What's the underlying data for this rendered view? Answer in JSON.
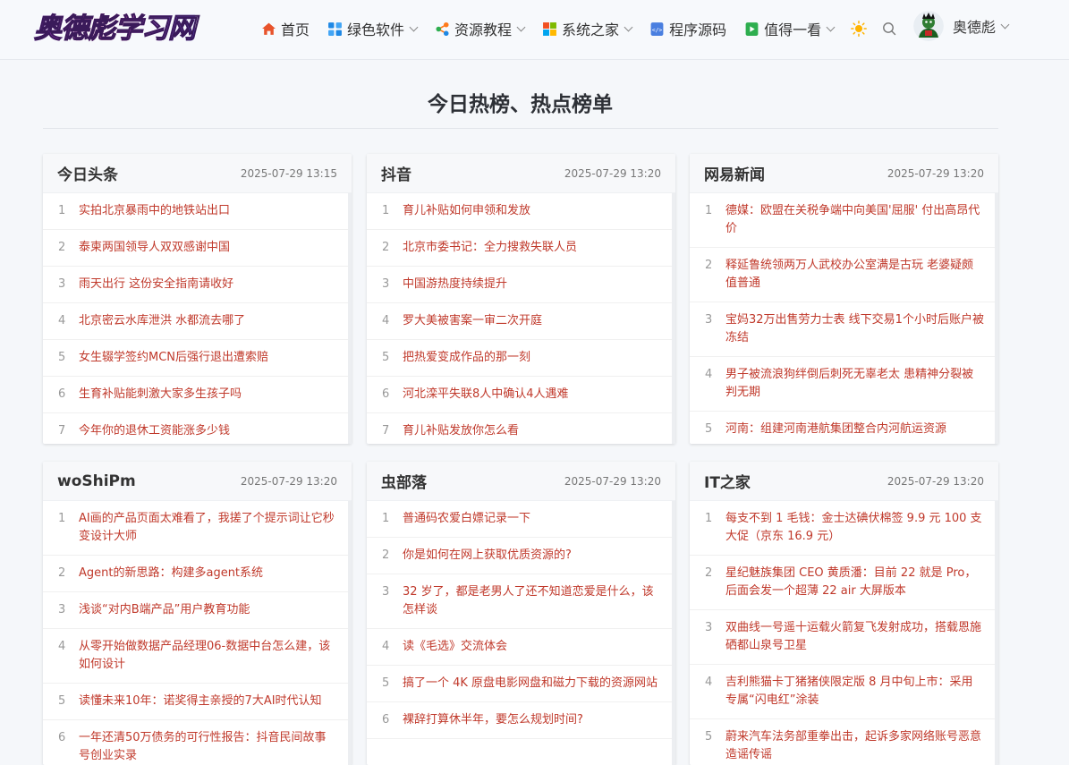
{
  "brand": {
    "logo_text": "奥德彪学习网"
  },
  "nav": {
    "items": [
      {
        "label": "首页",
        "icon": "home-icon",
        "color": "#e8532b",
        "dropdown": false
      },
      {
        "label": "绿色软件",
        "icon": "windows-grid-icon",
        "color": "#1e88e5",
        "dropdown": true
      },
      {
        "label": "资源教程",
        "icon": "share-nodes-icon",
        "color": "#ff7a1a",
        "dropdown": true
      },
      {
        "label": "系统之家",
        "icon": "windows-logo-icon",
        "color": "#e8532b",
        "dropdown": true
      },
      {
        "label": "程序源码",
        "icon": "code-file-icon",
        "color": "#4a7fe0",
        "dropdown": false
      },
      {
        "label": "值得一看",
        "icon": "film-icon",
        "color": "#2eae4f",
        "dropdown": true
      }
    ],
    "user": {
      "name": "奥德彪"
    }
  },
  "page": {
    "title": "今日热榜、热点榜单"
  },
  "colors": {
    "accent": "#c0392b",
    "background": "#f5f7fa"
  },
  "cards": [
    {
      "name": "今日头条",
      "time": "2025-07-29 13:15",
      "items": [
        "实拍北京暴雨中的地铁站出口",
        "泰柬两国领导人双双感谢中国",
        "雨天出行 这份安全指南请收好",
        "北京密云水库泄洪 水都流去哪了",
        "女生辍学签约MCN后强行退出遭索赔",
        "生育补贴能刺激大家多生孩子吗",
        "今年你的退休工资能涨多少钱"
      ]
    },
    {
      "name": "抖音",
      "time": "2025-07-29 13:20",
      "items": [
        "育儿补贴如何申领和发放",
        "北京市委书记：全力搜救失联人员",
        "中国游热度持续提升",
        "罗大美被害案一审二次开庭",
        "把热爱变成作品的那一刻",
        "河北滦平失联8人中确认4人遇难",
        "育儿补贴发放你怎么看"
      ]
    },
    {
      "name": "网易新闻",
      "time": "2025-07-29 13:20",
      "items": [
        "德媒：欧盟在关税争端中向美国'屈服' 付出高昂代价",
        "释延鲁统领两万人武校办公室满是古玩 老婆疑颇值普通",
        "宝妈32万出售劳力士表 线下交易1个小时后账户被冻结",
        "男子被流浪狗绊倒后刺死无辜老太 患精神分裂被判无期",
        "河南：组建河南港航集团整合内河航运资源"
      ]
    },
    {
      "name": "woShiPm",
      "time": "2025-07-29 13:20",
      "items": [
        "AI画的产品页面太难看了，我搓了个提示词让它秒变设计大师",
        "Agent的新思路：构建多agent系统",
        "浅谈“对内B端产品”用户教育功能",
        "从零开始做数据产品经理06-数据中台怎么建，该如何设计",
        "读懂未来10年：诺奖得主亲授的7大AI时代认知",
        "一年还清50万债务的可行性报告：抖音民间故事号创业实录"
      ]
    },
    {
      "name": "虫部落",
      "time": "2025-07-29 13:20",
      "items": [
        "普通码农爱白嫖记录一下",
        "你是如何在网上获取优质资源的?",
        "32 岁了，都是老男人了还不知道恋爱是什么，该怎样谈",
        "读《毛选》交流体会",
        "搞了一个 4K 原盘电影网盘和磁力下载的资源网站",
        "裸辞打算休半年，要怎么规划时间?"
      ]
    },
    {
      "name": "IT之家",
      "time": "2025-07-29 13:20",
      "items": [
        "每支不到 1 毛钱：金士达碘伏棉签 9.9 元 100 支大促（京东 16.9 元）",
        "星纪魅族集团 CEO 黄质潘：目前 22 就是 Pro，后面会发一个超薄 22 air 大屏版本",
        "双曲线一号遥十运载火箭复飞发射成功，搭载恩施硒都山泉号卫星",
        "吉利熊猫卡丁猪猪侠限定版 8 月中旬上市：采用专属“闪电红”涂装",
        "蔚来汽车法务部重拳出击，起诉多家网络账号恶意造谣传谣"
      ]
    }
  ]
}
